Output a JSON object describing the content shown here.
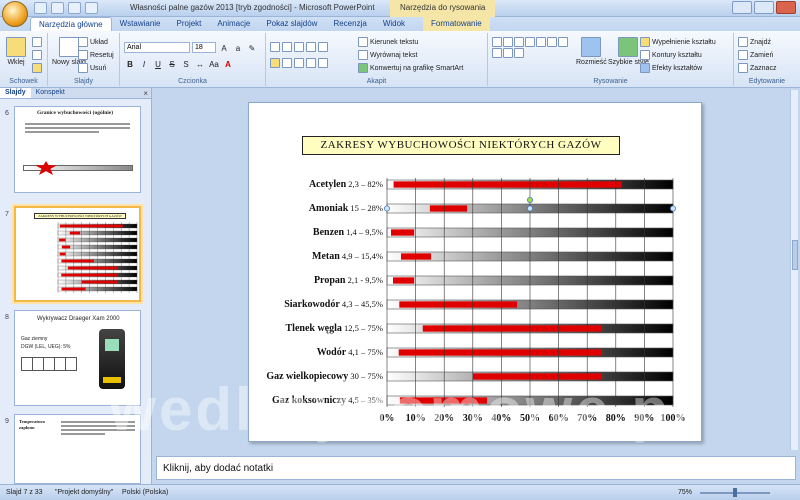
{
  "window": {
    "title": "Własności palne gazów 2013 [tryb zgodności] - Microsoft PowerPoint",
    "contextual_tool": "Narzędzia do rysowania"
  },
  "tabs": [
    "Narzędzia główne",
    "Wstawianie",
    "Projekt",
    "Animacje",
    "Pokaz slajdów",
    "Recenzja",
    "Widok",
    "Formatowanie"
  ],
  "ribbon": {
    "clipboard": {
      "label": "Schowek",
      "paste": "Wklej"
    },
    "slides": {
      "label": "Slajdy",
      "new_slide": "Nowy slajd",
      "layout": "Układ",
      "reset": "Resetuj",
      "delete": "Usuń"
    },
    "font": {
      "label": "Czcionka",
      "name": "Arial",
      "size": "18"
    },
    "paragraph": {
      "label": "Akapit",
      "text_direction": "Kierunek tekstu",
      "align_text": "Wyrównaj tekst",
      "smartart": "Konwertuj na grafikę SmartArt"
    },
    "drawing": {
      "label": "Rysowanie",
      "arrange": "Rozmieść",
      "quick_styles": "Szybkie style",
      "fill": "Wypełnienie kształtu",
      "outline": "Kontury kształtu",
      "effects": "Efekty kształtów"
    },
    "editing": {
      "label": "Edytowanie",
      "find": "Znajdź",
      "replace": "Zamień",
      "select": "Zaznacz"
    }
  },
  "panel": {
    "tabs": [
      "Slajdy",
      "Konspekt"
    ],
    "thumbnails": [
      {
        "number": "6",
        "title": "Granice wybuchowości (ogólnie)"
      },
      {
        "number": "7",
        "title": "ZAKRESY WYBUCHOWOŚCI NIEKTÓRYCH GAZÓW"
      },
      {
        "number": "8",
        "title": "Wykrywacz Draeger Xam 2000",
        "line1": "Gaz ziemny",
        "line2": "DGW (LEL, UEG): 5%"
      },
      {
        "number": "9",
        "title": "Temperatura zapłonu"
      }
    ]
  },
  "slide": {
    "title": "ZAKRESY  WYBUCHOWOŚCI  NIEKTÓRYCH  GAZÓW"
  },
  "chart_data": {
    "type": "bar",
    "title": "ZAKRESY  WYBUCHOWOŚCI  NIEKTÓRYCH  GAZÓW",
    "categories": [
      "Acetylen",
      "Amoniak",
      "Benzen",
      "Metan",
      "Propan",
      "Siarkowodór",
      "Tlenek węgla",
      "Wodór",
      "Gaz wielkopiecowy",
      "Gaz koksowniczy"
    ],
    "category_labels": [
      "2,3 – 82%",
      "15 – 28%",
      "1,4 – 9,5%",
      "4,9 – 15,4%",
      "2,1 - 9,5%",
      "4,3 – 45,5%",
      "12,5 – 75%",
      "4,1 – 75%",
      "30 – 75%",
      "4,5 – 35%"
    ],
    "series": [
      {
        "values_low": [
          2.3,
          15,
          1.4,
          4.9,
          2.1,
          4.3,
          12.5,
          4.1,
          30,
          4.5
        ],
        "values_high": [
          82,
          28,
          9.5,
          15.4,
          9.5,
          45.5,
          75,
          75,
          75,
          35
        ]
      }
    ],
    "x_ticks": [
      "0%",
      "10%",
      "20%",
      "30%",
      "40%",
      "50%",
      "60%",
      "70%",
      "80%",
      "90%",
      "100%"
    ],
    "xlim": [
      0,
      100
    ],
    "grid": true,
    "colors": {
      "range": "#e00000",
      "background_start": "#ffffff",
      "background_end": "#000000"
    }
  },
  "notes": {
    "placeholder": "Kliknij, aby dodać notatki"
  },
  "status": {
    "slide": "Slajd 7 z 33",
    "theme": "\"Projekt domyślny\"",
    "language": "Polski (Polska)",
    "zoom": "75%"
  },
  "watermark": "wedlinydomowe.pl"
}
